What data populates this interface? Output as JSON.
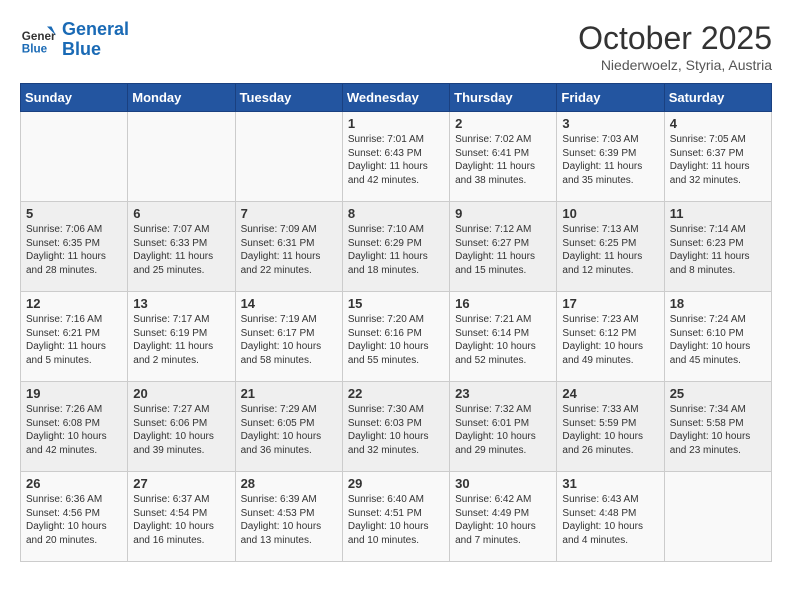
{
  "header": {
    "logo_general": "General",
    "logo_blue": "Blue",
    "month": "October 2025",
    "location": "Niederwoelz, Styria, Austria"
  },
  "weekdays": [
    "Sunday",
    "Monday",
    "Tuesday",
    "Wednesday",
    "Thursday",
    "Friday",
    "Saturday"
  ],
  "weeks": [
    [
      {
        "day": "",
        "info": ""
      },
      {
        "day": "",
        "info": ""
      },
      {
        "day": "",
        "info": ""
      },
      {
        "day": "1",
        "info": "Sunrise: 7:01 AM\nSunset: 6:43 PM\nDaylight: 11 hours\nand 42 minutes."
      },
      {
        "day": "2",
        "info": "Sunrise: 7:02 AM\nSunset: 6:41 PM\nDaylight: 11 hours\nand 38 minutes."
      },
      {
        "day": "3",
        "info": "Sunrise: 7:03 AM\nSunset: 6:39 PM\nDaylight: 11 hours\nand 35 minutes."
      },
      {
        "day": "4",
        "info": "Sunrise: 7:05 AM\nSunset: 6:37 PM\nDaylight: 11 hours\nand 32 minutes."
      }
    ],
    [
      {
        "day": "5",
        "info": "Sunrise: 7:06 AM\nSunset: 6:35 PM\nDaylight: 11 hours\nand 28 minutes."
      },
      {
        "day": "6",
        "info": "Sunrise: 7:07 AM\nSunset: 6:33 PM\nDaylight: 11 hours\nand 25 minutes."
      },
      {
        "day": "7",
        "info": "Sunrise: 7:09 AM\nSunset: 6:31 PM\nDaylight: 11 hours\nand 22 minutes."
      },
      {
        "day": "8",
        "info": "Sunrise: 7:10 AM\nSunset: 6:29 PM\nDaylight: 11 hours\nand 18 minutes."
      },
      {
        "day": "9",
        "info": "Sunrise: 7:12 AM\nSunset: 6:27 PM\nDaylight: 11 hours\nand 15 minutes."
      },
      {
        "day": "10",
        "info": "Sunrise: 7:13 AM\nSunset: 6:25 PM\nDaylight: 11 hours\nand 12 minutes."
      },
      {
        "day": "11",
        "info": "Sunrise: 7:14 AM\nSunset: 6:23 PM\nDaylight: 11 hours\nand 8 minutes."
      }
    ],
    [
      {
        "day": "12",
        "info": "Sunrise: 7:16 AM\nSunset: 6:21 PM\nDaylight: 11 hours\nand 5 minutes."
      },
      {
        "day": "13",
        "info": "Sunrise: 7:17 AM\nSunset: 6:19 PM\nDaylight: 11 hours\nand 2 minutes."
      },
      {
        "day": "14",
        "info": "Sunrise: 7:19 AM\nSunset: 6:17 PM\nDaylight: 10 hours\nand 58 minutes."
      },
      {
        "day": "15",
        "info": "Sunrise: 7:20 AM\nSunset: 6:16 PM\nDaylight: 10 hours\nand 55 minutes."
      },
      {
        "day": "16",
        "info": "Sunrise: 7:21 AM\nSunset: 6:14 PM\nDaylight: 10 hours\nand 52 minutes."
      },
      {
        "day": "17",
        "info": "Sunrise: 7:23 AM\nSunset: 6:12 PM\nDaylight: 10 hours\nand 49 minutes."
      },
      {
        "day": "18",
        "info": "Sunrise: 7:24 AM\nSunset: 6:10 PM\nDaylight: 10 hours\nand 45 minutes."
      }
    ],
    [
      {
        "day": "19",
        "info": "Sunrise: 7:26 AM\nSunset: 6:08 PM\nDaylight: 10 hours\nand 42 minutes."
      },
      {
        "day": "20",
        "info": "Sunrise: 7:27 AM\nSunset: 6:06 PM\nDaylight: 10 hours\nand 39 minutes."
      },
      {
        "day": "21",
        "info": "Sunrise: 7:29 AM\nSunset: 6:05 PM\nDaylight: 10 hours\nand 36 minutes."
      },
      {
        "day": "22",
        "info": "Sunrise: 7:30 AM\nSunset: 6:03 PM\nDaylight: 10 hours\nand 32 minutes."
      },
      {
        "day": "23",
        "info": "Sunrise: 7:32 AM\nSunset: 6:01 PM\nDaylight: 10 hours\nand 29 minutes."
      },
      {
        "day": "24",
        "info": "Sunrise: 7:33 AM\nSunset: 5:59 PM\nDaylight: 10 hours\nand 26 minutes."
      },
      {
        "day": "25",
        "info": "Sunrise: 7:34 AM\nSunset: 5:58 PM\nDaylight: 10 hours\nand 23 minutes."
      }
    ],
    [
      {
        "day": "26",
        "info": "Sunrise: 6:36 AM\nSunset: 4:56 PM\nDaylight: 10 hours\nand 20 minutes."
      },
      {
        "day": "27",
        "info": "Sunrise: 6:37 AM\nSunset: 4:54 PM\nDaylight: 10 hours\nand 16 minutes."
      },
      {
        "day": "28",
        "info": "Sunrise: 6:39 AM\nSunset: 4:53 PM\nDaylight: 10 hours\nand 13 minutes."
      },
      {
        "day": "29",
        "info": "Sunrise: 6:40 AM\nSunset: 4:51 PM\nDaylight: 10 hours\nand 10 minutes."
      },
      {
        "day": "30",
        "info": "Sunrise: 6:42 AM\nSunset: 4:49 PM\nDaylight: 10 hours\nand 7 minutes."
      },
      {
        "day": "31",
        "info": "Sunrise: 6:43 AM\nSunset: 4:48 PM\nDaylight: 10 hours\nand 4 minutes."
      },
      {
        "day": "",
        "info": ""
      }
    ]
  ]
}
